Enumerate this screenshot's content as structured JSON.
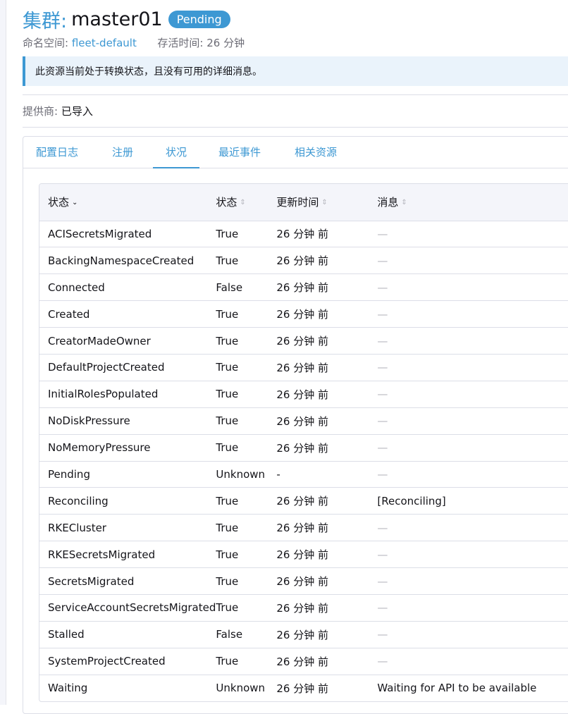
{
  "header": {
    "type_label": "集群:",
    "name": "master01",
    "state": "Pending"
  },
  "meta": {
    "namespace_label": "命名空间:",
    "namespace_value": "fleet-default",
    "age_label": "存活时间:",
    "age_value": "26 分钟"
  },
  "banner": {
    "message": "此资源当前处于转换状态，且没有可用的详细消息。"
  },
  "provider": {
    "label": "提供商:",
    "value": "已导入"
  },
  "tabs": [
    {
      "label": "配置日志"
    },
    {
      "label": "注册"
    },
    {
      "label": "状况"
    },
    {
      "label": "最近事件"
    },
    {
      "label": "相关资源"
    }
  ],
  "table": {
    "headers": [
      "状态",
      "状态",
      "更新时间",
      "消息"
    ],
    "rows": [
      [
        "ACISecretsMigrated",
        "True",
        "26 分钟 前",
        "—"
      ],
      [
        "BackingNamespaceCreated",
        "True",
        "26 分钟 前",
        "—"
      ],
      [
        "Connected",
        "False",
        "26 分钟 前",
        "—"
      ],
      [
        "Created",
        "True",
        "26 分钟 前",
        "—"
      ],
      [
        "CreatorMadeOwner",
        "True",
        "26 分钟 前",
        "—"
      ],
      [
        "DefaultProjectCreated",
        "True",
        "26 分钟 前",
        "—"
      ],
      [
        "InitialRolesPopulated",
        "True",
        "26 分钟 前",
        "—"
      ],
      [
        "NoDiskPressure",
        "True",
        "26 分钟 前",
        "—"
      ],
      [
        "NoMemoryPressure",
        "True",
        "26 分钟 前",
        "—"
      ],
      [
        "Pending",
        "Unknown",
        "-",
        "—"
      ],
      [
        "Reconciling",
        "True",
        "26 分钟 前",
        "[Reconciling]"
      ],
      [
        "RKECluster",
        "True",
        "26 分钟 前",
        "—"
      ],
      [
        "RKESecretsMigrated",
        "True",
        "26 分钟 前",
        "—"
      ],
      [
        "SecretsMigrated",
        "True",
        "26 分钟 前",
        "—"
      ],
      [
        "ServiceAccountSecretsMigrated",
        "True",
        "26 分钟 前",
        "—"
      ],
      [
        "Stalled",
        "False",
        "26 分钟 前",
        "—"
      ],
      [
        "SystemProjectCreated",
        "True",
        "26 分钟 前",
        "—"
      ],
      [
        "Waiting",
        "Unknown",
        "26 分钟 前",
        "Waiting for API to be available"
      ]
    ]
  },
  "colors": {
    "accent": "#3d98d3",
    "banner_bg": "#eaf3fb",
    "header_bg": "#f4f5fa"
  }
}
